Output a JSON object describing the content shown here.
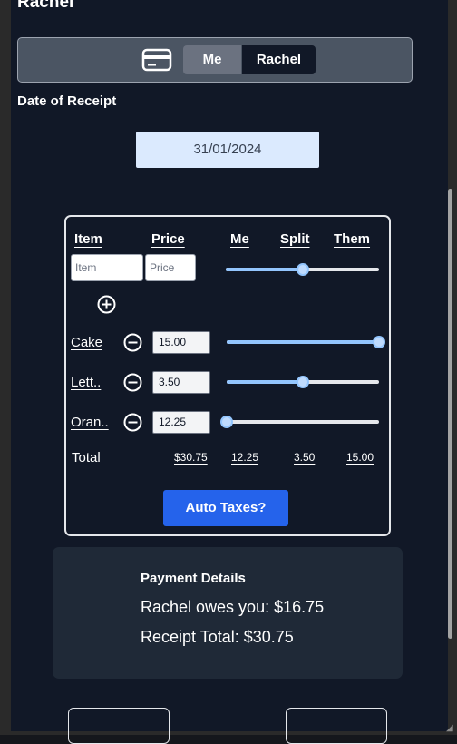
{
  "header": {
    "other_person": "Rachel"
  },
  "payer_toggle": {
    "icon": "credit-card-icon",
    "options": [
      "Me",
      "Rachel"
    ],
    "selected": "Me"
  },
  "receipt": {
    "date_label": "Date of Receipt",
    "date_value": "31/01/2024"
  },
  "table": {
    "headers": {
      "item": "Item",
      "price": "Price",
      "me": "Me",
      "split": "Split",
      "them": "Them"
    },
    "new_item": {
      "item_placeholder": "Item",
      "price_placeholder": "Price",
      "split_fraction": 0.5
    },
    "add_icon": "plus-circle-icon",
    "remove_icon": "minus-circle-icon",
    "rows": [
      {
        "label": "Cake",
        "price": "15.00",
        "split_fraction": 1.0
      },
      {
        "label": "Lett..",
        "price": "3.50",
        "split_fraction": 0.5
      },
      {
        "label": "Oran..",
        "price": "12.25",
        "split_fraction": 0.0
      }
    ],
    "totals": {
      "label": "Total",
      "price": "$30.75",
      "me": "12.25",
      "split": "3.50",
      "them": "15.00"
    }
  },
  "auto_taxes_label": "Auto Taxes?",
  "payment": {
    "title": "Payment Details",
    "owes_line": "Rachel owes you: $16.75",
    "total_line": "Receipt Total: $30.75"
  },
  "colors": {
    "background": "#111827",
    "accent_blue": "#2563eb",
    "slider_fill": "#93c5fd",
    "date_field": "#dbeafe"
  }
}
